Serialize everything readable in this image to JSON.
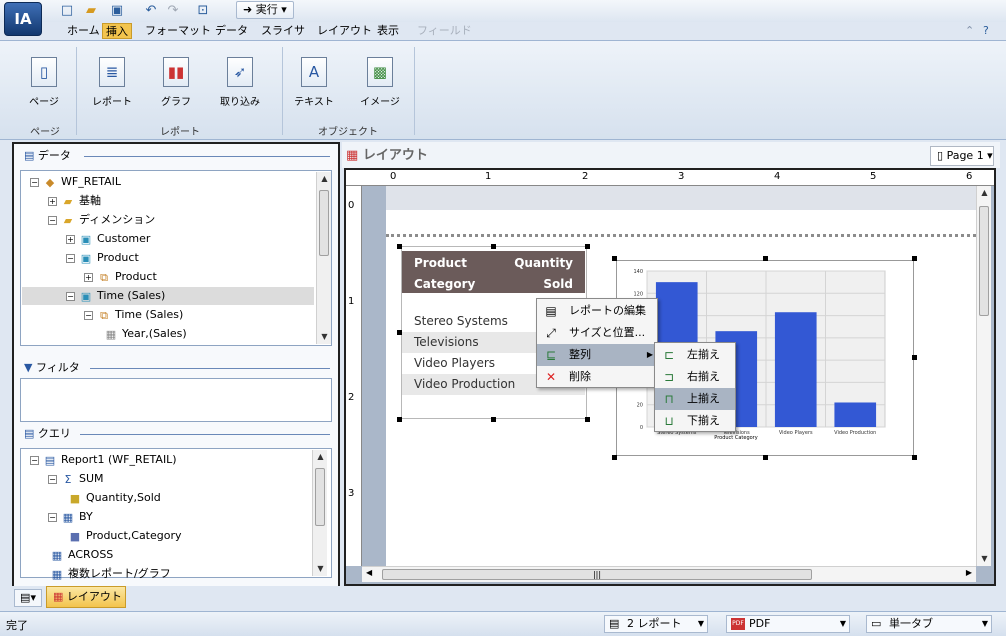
{
  "app": {
    "logo": "IA"
  },
  "quick_access": {
    "run_label": "実行"
  },
  "menu": [
    "ホーム",
    "挿入",
    "フォーマット",
    "データ",
    "スライサ",
    "レイアウト",
    "表示",
    "フィールド"
  ],
  "menu_active": "挿入",
  "ribbon": {
    "buttons": [
      "ページ",
      "レポート",
      "グラフ",
      "取り込み",
      "テキスト",
      "イメージ"
    ],
    "groups": [
      "ページ",
      "レポート",
      "オブジェクト"
    ]
  },
  "data_panel": {
    "title": "データ",
    "items": [
      {
        "label": "WF_RETAIL",
        "level": 0,
        "exp": "−"
      },
      {
        "label": "基軸",
        "level": 1,
        "exp": "+"
      },
      {
        "label": "ディメンション",
        "level": 1,
        "exp": "−"
      },
      {
        "label": "Customer",
        "level": 2,
        "exp": "+"
      },
      {
        "label": "Product",
        "level": 2,
        "exp": "−"
      },
      {
        "label": "Product",
        "level": 3,
        "exp": "+"
      },
      {
        "label": "Time (Sales)",
        "level": 2,
        "exp": "−",
        "selected": true
      },
      {
        "label": "Time (Sales)",
        "level": 3,
        "exp": "−"
      },
      {
        "label": "Year,(Sales)",
        "level": 4,
        "exp": ""
      }
    ]
  },
  "filter_panel": {
    "title": "フィルタ"
  },
  "query_panel": {
    "title": "クエリ",
    "items": [
      {
        "label": "Report1 (WF_RETAIL)",
        "level": 0,
        "exp": "−"
      },
      {
        "label": "SUM",
        "level": 1,
        "exp": "−"
      },
      {
        "label": "Quantity,Sold",
        "level": 2,
        "exp": ""
      },
      {
        "label": "BY",
        "level": 1,
        "exp": "−"
      },
      {
        "label": "Product,Category",
        "level": 2,
        "exp": ""
      },
      {
        "label": "ACROSS",
        "level": 1,
        "exp": ""
      },
      {
        "label": "複数レポート/グラフ",
        "level": 1,
        "exp": ""
      }
    ]
  },
  "layout": {
    "title": "レイアウト",
    "page_button": "Page 1",
    "ruler": [
      "0",
      "1",
      "2",
      "3",
      "4",
      "5",
      "6"
    ],
    "vruler": [
      "0",
      "1",
      "2",
      "3"
    ]
  },
  "report": {
    "header_left": [
      "Product",
      "Category"
    ],
    "header_right": [
      "Quantity",
      "Sold"
    ],
    "rows": [
      "Stereo Systems",
      "Televisions",
      "Video Players",
      "Video Production"
    ]
  },
  "chart_data": {
    "type": "bar",
    "categories": [
      "Stereo Systems",
      "Televisions",
      "Video Players",
      "Video Production"
    ],
    "values": [
      130,
      86,
      103,
      22
    ],
    "ylim": [
      0,
      140
    ],
    "yticks": [
      "140",
      "120",
      "100",
      "80",
      "60",
      "40",
      "20",
      "0"
    ],
    "xlabel": "Product Category",
    "bar_color": "#3358d4"
  },
  "context_menu": {
    "items": [
      "レポートの編集",
      "サイズと位置...",
      "整列",
      "削除"
    ],
    "highlighted": "整列"
  },
  "submenu": {
    "items": [
      "左揃え",
      "右揃え",
      "上揃え",
      "下揃え"
    ],
    "highlighted": "上揃え"
  },
  "bottom_tab": {
    "label": "レイアウト"
  },
  "status": {
    "text": "完了",
    "reports": "2 レポート",
    "format": "PDF",
    "tab_mode": "単一タブ"
  },
  "colors": {
    "header_bg": "#6b5b5a",
    "accent": "#f3c44d",
    "bar": "#3358d4"
  }
}
